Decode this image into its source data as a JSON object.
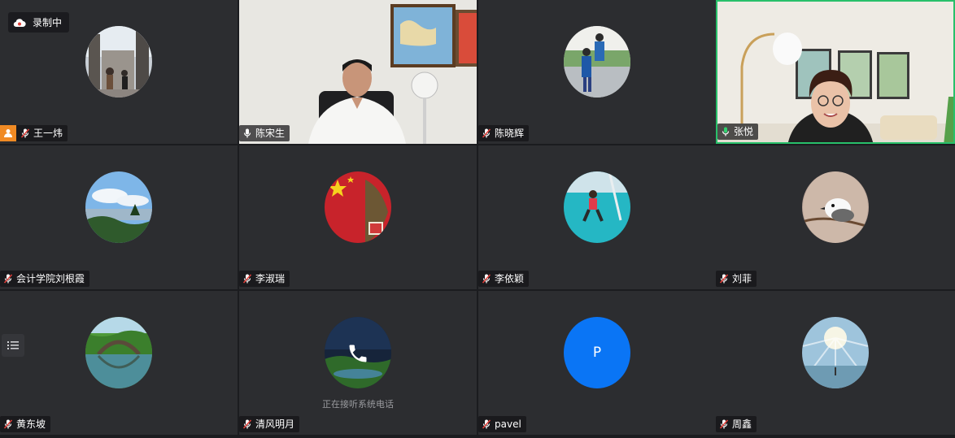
{
  "recording": {
    "label": "录制中"
  },
  "participants": [
    {
      "name": "王一炜",
      "type": "avatar",
      "host": true
    },
    {
      "name": "陈宋生",
      "type": "video"
    },
    {
      "name": "陈晓辉",
      "type": "avatar"
    },
    {
      "name": "张悦",
      "type": "video",
      "speaking": true
    },
    {
      "name": "会计学院刘根霞",
      "type": "avatar"
    },
    {
      "name": "李淑瑞",
      "type": "avatar"
    },
    {
      "name": "李依颖",
      "type": "avatar"
    },
    {
      "name": "刘菲",
      "type": "avatar"
    },
    {
      "name": "黄东坡",
      "type": "avatar"
    },
    {
      "name": "清风明月",
      "type": "phone",
      "status": "正在接听系统电话"
    },
    {
      "name": "pavel",
      "type": "initial",
      "initial": "P"
    },
    {
      "name": "周鑫",
      "type": "avatar"
    }
  ],
  "colors": {
    "speaking_border": "#28c06a",
    "host_badge": "#f08a24",
    "initial_avatar": "#0a75f5",
    "tile_bg": "#2c2d30"
  },
  "icons": {
    "recording": "cloud-record-icon",
    "mic_muted": "mic-muted-icon",
    "mic_active": "mic-active-icon",
    "menu": "list-menu-icon",
    "phone": "phone-icon",
    "host": "host-person-icon"
  }
}
